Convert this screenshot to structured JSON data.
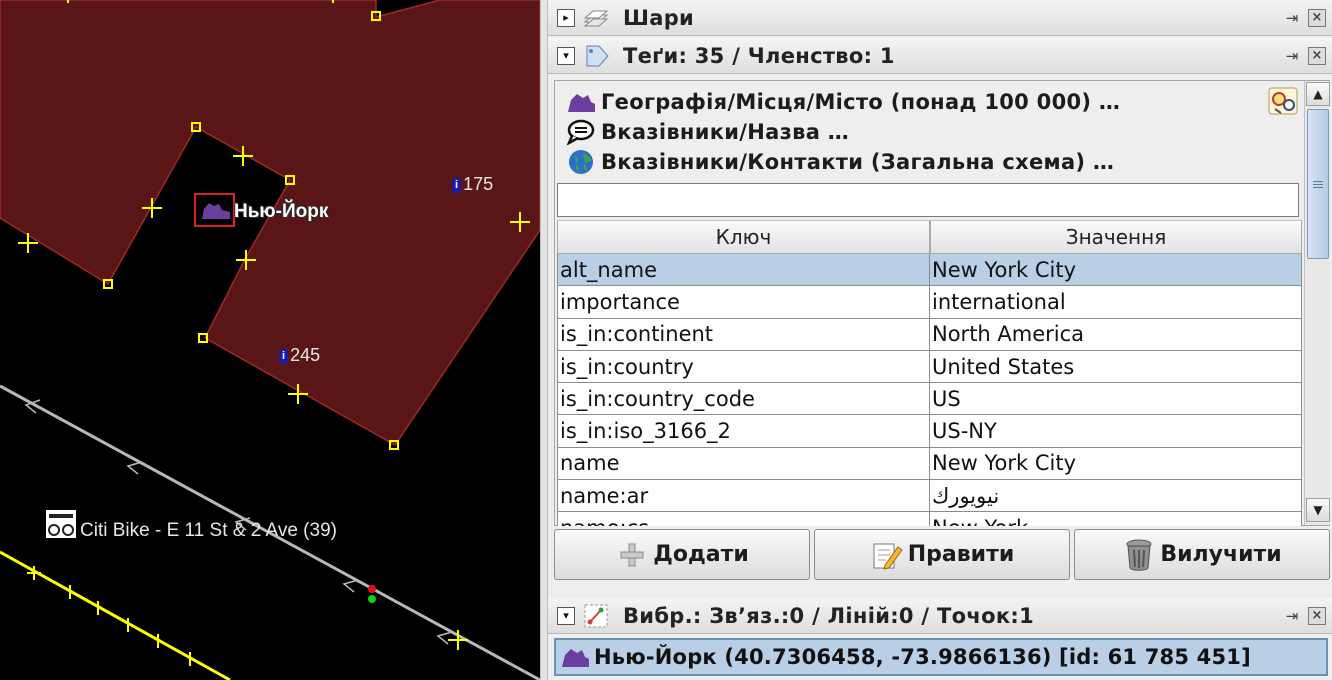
{
  "map": {
    "place_label": "Нью-Йорк",
    "node_labels": [
      {
        "badge": "i",
        "text": "175"
      },
      {
        "badge": "i",
        "text": "245"
      }
    ],
    "bike_label": "Citi Bike - E 11 St & 2 Ave (39)"
  },
  "panels": {
    "layers": {
      "title": "Шари"
    },
    "tags": {
      "title": "Теґи: 35 / Членство: 1"
    },
    "selection": {
      "title": "Вибр.: Зв’яз.:0 / Ліній:0 / Точок:1"
    }
  },
  "presets": [
    {
      "icon": "city-icon",
      "label": "Географія/Місця/Місто (понад 100 000) …"
    },
    {
      "icon": "speech-bubble-icon",
      "label": "Вказівники/Назва …"
    },
    {
      "icon": "globe-icon",
      "label": "Вказівники/Контакти (Загальна схема) …"
    }
  ],
  "filter": {
    "value": ""
  },
  "table": {
    "headers": {
      "key": "Ключ",
      "value": "Значення"
    },
    "rows": [
      {
        "key": "alt_name",
        "value": "New York City"
      },
      {
        "key": "importance",
        "value": "international"
      },
      {
        "key": "is_in:continent",
        "value": "North America"
      },
      {
        "key": "is_in:country",
        "value": "United States"
      },
      {
        "key": "is_in:country_code",
        "value": "US"
      },
      {
        "key": "is_in:iso_3166_2",
        "value": "US-NY"
      },
      {
        "key": "name",
        "value": "New York City"
      },
      {
        "key": "name:ar",
        "value": "نيويورك"
      },
      {
        "key": "name:cs",
        "value": "New York"
      }
    ],
    "selected_row": 0
  },
  "buttons": {
    "add": "Додати",
    "edit": "Правити",
    "delete": "Вилучити"
  },
  "selection_item": "Нью-Йорк (40.7306458, -73.9866136) [id: 61 785 451]",
  "colors": {
    "map_background": "#000000",
    "building_fill": "#5a1616",
    "building_outline": "#a02828",
    "vertex": "#ffff00",
    "selection_highlight": "#b8cfe5",
    "place_icon": "#6b3fa0"
  }
}
